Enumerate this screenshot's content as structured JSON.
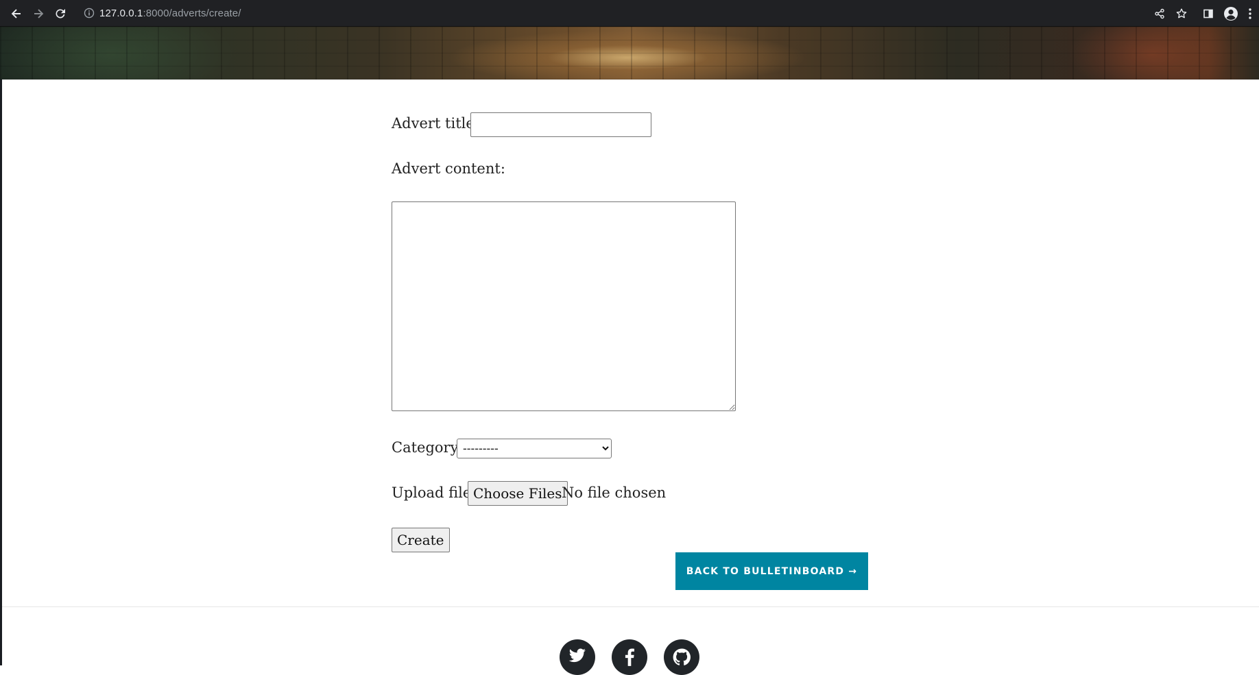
{
  "browser": {
    "url_host": "127.0.0.1",
    "url_rest": ":8000/adverts/create/",
    "icons": [
      "back-arrow-icon",
      "forward-arrow-icon",
      "reload-icon",
      "info-icon",
      "share-icon",
      "star-icon",
      "side-panel-icon",
      "profile-icon",
      "kebab-menu-icon"
    ]
  },
  "form": {
    "title_label": "Advert title:",
    "title_value": "",
    "content_label": "Advert content:",
    "content_value": "",
    "category_label": "Category:",
    "category_selected": "---------",
    "upload_label": "Upload file:",
    "upload_button": "Choose Files",
    "upload_status": "No file chosen",
    "submit_label": "Create"
  },
  "back_link": {
    "label": "BACK TO BULLETINBOARD →",
    "color": "#0085a1"
  },
  "footer": {
    "social": [
      "twitter-icon",
      "facebook-icon",
      "github-icon"
    ],
    "icon_bg": "#212529"
  }
}
